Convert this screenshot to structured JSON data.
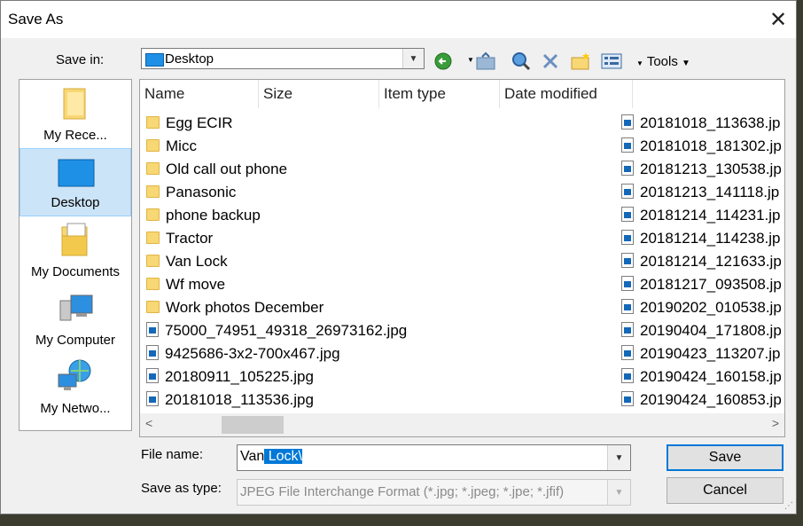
{
  "window": {
    "title": "Save As",
    "close_glyph": "✕"
  },
  "toolbar": {
    "save_in_label": "Save in:",
    "save_in_value": "Desktop",
    "tools_label": "Tools",
    "icons": [
      "back-icon",
      "up-folder-icon",
      "search-web-icon",
      "delete-icon",
      "new-folder-icon",
      "views-icon"
    ]
  },
  "places": [
    {
      "label": "My Rece...",
      "icon": "recent-folder-icon",
      "selected": false
    },
    {
      "label": "Desktop",
      "icon": "desktop-icon",
      "selected": true
    },
    {
      "label": "My Documents",
      "icon": "documents-icon",
      "selected": false
    },
    {
      "label": "My Computer",
      "icon": "computer-icon",
      "selected": false
    },
    {
      "label": "My Netwo...",
      "icon": "network-icon",
      "selected": false
    }
  ],
  "columns": [
    "Name",
    "Size",
    "Item type",
    "Date modified"
  ],
  "files_left": [
    {
      "name": "Egg ECIR",
      "kind": "folder"
    },
    {
      "name": "Micc",
      "kind": "folder"
    },
    {
      "name": "Old call out phone",
      "kind": "folder"
    },
    {
      "name": "Panasonic",
      "kind": "folder"
    },
    {
      "name": "phone backup",
      "kind": "folder"
    },
    {
      "name": "Tractor",
      "kind": "folder"
    },
    {
      "name": "Van Lock",
      "kind": "folder"
    },
    {
      "name": "Wf move",
      "kind": "folder"
    },
    {
      "name": "Work photos December",
      "kind": "folder"
    },
    {
      "name": "75000_74951_49318_26973162.jpg",
      "kind": "jpg"
    },
    {
      "name": "9425686-3x2-700x467.jpg",
      "kind": "jpg"
    },
    {
      "name": "20180911_105225.jpg",
      "kind": "jpg"
    },
    {
      "name": "20181018_113536.jpg",
      "kind": "jpg"
    }
  ],
  "files_right": [
    "20181018_113638.jp",
    "20181018_181302.jp",
    "20181213_130538.jp",
    "20181213_141118.jp",
    "20181214_114231.jp",
    "20181214_114238.jp",
    "20181214_121633.jp",
    "20181217_093508.jp",
    "20190202_010538.jp",
    "20190404_171808.jp",
    "20190423_113207.jp",
    "20190424_160158.jp",
    "20190424_160853.jp"
  ],
  "filename": {
    "label": "File name:",
    "prefix": "Van",
    "selected": " Lock\\"
  },
  "savetype": {
    "label": "Save as type:",
    "value": "JPEG File Interchange Format (*.jpg; *.jpeg; *.jpe; *.jfif)"
  },
  "buttons": {
    "save": "Save",
    "cancel": "Cancel"
  },
  "colors": {
    "selection": "#0078d7",
    "place_selected": "#cce4f7",
    "folder": "#f8d775"
  }
}
